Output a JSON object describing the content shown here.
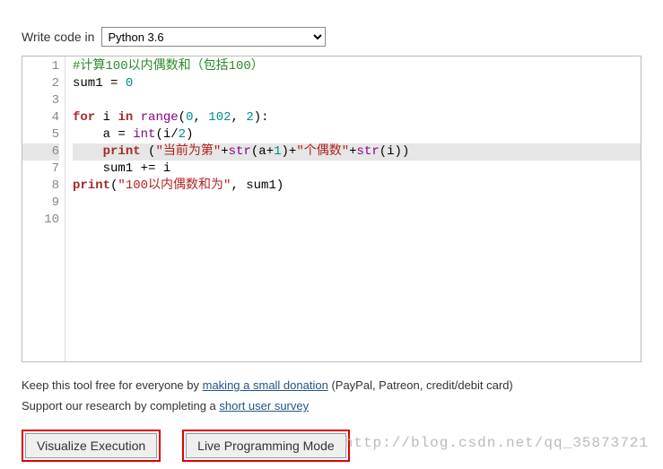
{
  "language_row": {
    "label": "Write code in",
    "selected": "Python 3.6"
  },
  "editor": {
    "highlighted_line": 6,
    "lines": [
      {
        "n": 1,
        "tokens": [
          {
            "t": "#计算100以内偶数和（包括100）",
            "c": "tok-comment"
          }
        ]
      },
      {
        "n": 2,
        "tokens": [
          {
            "t": "sum1 ",
            "c": "tok-name"
          },
          {
            "t": "= ",
            "c": "tok-op"
          },
          {
            "t": "0",
            "c": "tok-number"
          }
        ]
      },
      {
        "n": 3,
        "tokens": []
      },
      {
        "n": 4,
        "tokens": [
          {
            "t": "for",
            "c": "tok-keyword"
          },
          {
            "t": " i ",
            "c": "tok-name"
          },
          {
            "t": "in",
            "c": "tok-keyword"
          },
          {
            "t": " ",
            "c": ""
          },
          {
            "t": "range",
            "c": "tok-builtin"
          },
          {
            "t": "(",
            "c": "tok-punct"
          },
          {
            "t": "0",
            "c": "tok-number"
          },
          {
            "t": ", ",
            "c": "tok-punct"
          },
          {
            "t": "102",
            "c": "tok-number"
          },
          {
            "t": ", ",
            "c": "tok-punct"
          },
          {
            "t": "2",
            "c": "tok-number"
          },
          {
            "t": "):",
            "c": "tok-punct"
          }
        ]
      },
      {
        "n": 5,
        "tokens": [
          {
            "t": "    a ",
            "c": "tok-name"
          },
          {
            "t": "= ",
            "c": "tok-op"
          },
          {
            "t": "int",
            "c": "tok-builtin"
          },
          {
            "t": "(i",
            "c": "tok-name"
          },
          {
            "t": "/",
            "c": "tok-op"
          },
          {
            "t": "2",
            "c": "tok-number"
          },
          {
            "t": ")",
            "c": "tok-punct"
          }
        ]
      },
      {
        "n": 6,
        "tokens": [
          {
            "t": "    ",
            "c": ""
          },
          {
            "t": "print",
            "c": "tok-keyword"
          },
          {
            "t": " (",
            "c": "tok-punct"
          },
          {
            "t": "\"当前为第\"",
            "c": "tok-string"
          },
          {
            "t": "+",
            "c": "tok-op"
          },
          {
            "t": "str",
            "c": "tok-builtin"
          },
          {
            "t": "(a",
            "c": "tok-name"
          },
          {
            "t": "+",
            "c": "tok-op"
          },
          {
            "t": "1",
            "c": "tok-number"
          },
          {
            "t": ")",
            "c": "tok-punct"
          },
          {
            "t": "+",
            "c": "tok-op"
          },
          {
            "t": "\"个偶数\"",
            "c": "tok-string"
          },
          {
            "t": "+",
            "c": "tok-op"
          },
          {
            "t": "str",
            "c": "tok-builtin"
          },
          {
            "t": "(i))",
            "c": "tok-punct"
          }
        ]
      },
      {
        "n": 7,
        "tokens": [
          {
            "t": "    sum1 ",
            "c": "tok-name"
          },
          {
            "t": "+= ",
            "c": "tok-op"
          },
          {
            "t": "i",
            "c": "tok-name"
          }
        ]
      },
      {
        "n": 8,
        "tokens": [
          {
            "t": "print",
            "c": "tok-keyword"
          },
          {
            "t": "(",
            "c": "tok-punct"
          },
          {
            "t": "\"100以内偶数和为\"",
            "c": "tok-string"
          },
          {
            "t": ", sum1)",
            "c": "tok-punct"
          }
        ]
      },
      {
        "n": 9,
        "tokens": []
      },
      {
        "n": 10,
        "tokens": []
      }
    ]
  },
  "footer": {
    "donation_prefix": "Keep this tool free for everyone by ",
    "donation_link": "making a small donation",
    "donation_suffix": " (PayPal, Patreon, credit/debit card)",
    "survey_prefix": "Support our research by completing a ",
    "survey_link": "short user survey"
  },
  "buttons": {
    "visualize": "Visualize Execution",
    "live": "Live Programming Mode"
  },
  "watermark": "http://blog.csdn.net/qq_35873721"
}
